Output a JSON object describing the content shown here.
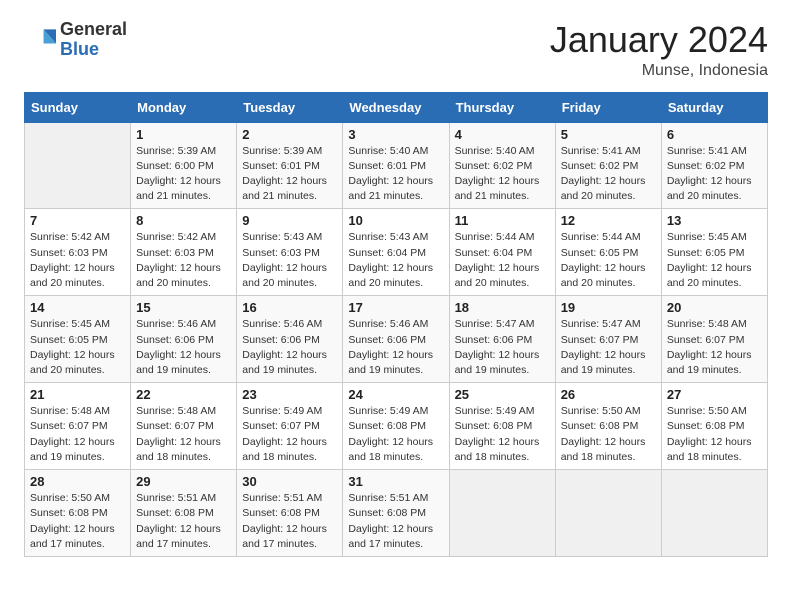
{
  "header": {
    "logo_general": "General",
    "logo_blue": "Blue",
    "month_title": "January 2024",
    "location": "Munse, Indonesia"
  },
  "days_of_week": [
    "Sunday",
    "Monday",
    "Tuesday",
    "Wednesday",
    "Thursday",
    "Friday",
    "Saturday"
  ],
  "weeks": [
    [
      {
        "day": "",
        "info": ""
      },
      {
        "day": "1",
        "info": "Sunrise: 5:39 AM\nSunset: 6:00 PM\nDaylight: 12 hours\nand 21 minutes."
      },
      {
        "day": "2",
        "info": "Sunrise: 5:39 AM\nSunset: 6:01 PM\nDaylight: 12 hours\nand 21 minutes."
      },
      {
        "day": "3",
        "info": "Sunrise: 5:40 AM\nSunset: 6:01 PM\nDaylight: 12 hours\nand 21 minutes."
      },
      {
        "day": "4",
        "info": "Sunrise: 5:40 AM\nSunset: 6:02 PM\nDaylight: 12 hours\nand 21 minutes."
      },
      {
        "day": "5",
        "info": "Sunrise: 5:41 AM\nSunset: 6:02 PM\nDaylight: 12 hours\nand 20 minutes."
      },
      {
        "day": "6",
        "info": "Sunrise: 5:41 AM\nSunset: 6:02 PM\nDaylight: 12 hours\nand 20 minutes."
      }
    ],
    [
      {
        "day": "7",
        "info": "Sunrise: 5:42 AM\nSunset: 6:03 PM\nDaylight: 12 hours\nand 20 minutes."
      },
      {
        "day": "8",
        "info": "Sunrise: 5:42 AM\nSunset: 6:03 PM\nDaylight: 12 hours\nand 20 minutes."
      },
      {
        "day": "9",
        "info": "Sunrise: 5:43 AM\nSunset: 6:03 PM\nDaylight: 12 hours\nand 20 minutes."
      },
      {
        "day": "10",
        "info": "Sunrise: 5:43 AM\nSunset: 6:04 PM\nDaylight: 12 hours\nand 20 minutes."
      },
      {
        "day": "11",
        "info": "Sunrise: 5:44 AM\nSunset: 6:04 PM\nDaylight: 12 hours\nand 20 minutes."
      },
      {
        "day": "12",
        "info": "Sunrise: 5:44 AM\nSunset: 6:05 PM\nDaylight: 12 hours\nand 20 minutes."
      },
      {
        "day": "13",
        "info": "Sunrise: 5:45 AM\nSunset: 6:05 PM\nDaylight: 12 hours\nand 20 minutes."
      }
    ],
    [
      {
        "day": "14",
        "info": "Sunrise: 5:45 AM\nSunset: 6:05 PM\nDaylight: 12 hours\nand 20 minutes."
      },
      {
        "day": "15",
        "info": "Sunrise: 5:46 AM\nSunset: 6:06 PM\nDaylight: 12 hours\nand 19 minutes."
      },
      {
        "day": "16",
        "info": "Sunrise: 5:46 AM\nSunset: 6:06 PM\nDaylight: 12 hours\nand 19 minutes."
      },
      {
        "day": "17",
        "info": "Sunrise: 5:46 AM\nSunset: 6:06 PM\nDaylight: 12 hours\nand 19 minutes."
      },
      {
        "day": "18",
        "info": "Sunrise: 5:47 AM\nSunset: 6:06 PM\nDaylight: 12 hours\nand 19 minutes."
      },
      {
        "day": "19",
        "info": "Sunrise: 5:47 AM\nSunset: 6:07 PM\nDaylight: 12 hours\nand 19 minutes."
      },
      {
        "day": "20",
        "info": "Sunrise: 5:48 AM\nSunset: 6:07 PM\nDaylight: 12 hours\nand 19 minutes."
      }
    ],
    [
      {
        "day": "21",
        "info": "Sunrise: 5:48 AM\nSunset: 6:07 PM\nDaylight: 12 hours\nand 19 minutes."
      },
      {
        "day": "22",
        "info": "Sunrise: 5:48 AM\nSunset: 6:07 PM\nDaylight: 12 hours\nand 18 minutes."
      },
      {
        "day": "23",
        "info": "Sunrise: 5:49 AM\nSunset: 6:07 PM\nDaylight: 12 hours\nand 18 minutes."
      },
      {
        "day": "24",
        "info": "Sunrise: 5:49 AM\nSunset: 6:08 PM\nDaylight: 12 hours\nand 18 minutes."
      },
      {
        "day": "25",
        "info": "Sunrise: 5:49 AM\nSunset: 6:08 PM\nDaylight: 12 hours\nand 18 minutes."
      },
      {
        "day": "26",
        "info": "Sunrise: 5:50 AM\nSunset: 6:08 PM\nDaylight: 12 hours\nand 18 minutes."
      },
      {
        "day": "27",
        "info": "Sunrise: 5:50 AM\nSunset: 6:08 PM\nDaylight: 12 hours\nand 18 minutes."
      }
    ],
    [
      {
        "day": "28",
        "info": "Sunrise: 5:50 AM\nSunset: 6:08 PM\nDaylight: 12 hours\nand 17 minutes."
      },
      {
        "day": "29",
        "info": "Sunrise: 5:51 AM\nSunset: 6:08 PM\nDaylight: 12 hours\nand 17 minutes."
      },
      {
        "day": "30",
        "info": "Sunrise: 5:51 AM\nSunset: 6:08 PM\nDaylight: 12 hours\nand 17 minutes."
      },
      {
        "day": "31",
        "info": "Sunrise: 5:51 AM\nSunset: 6:08 PM\nDaylight: 12 hours\nand 17 minutes."
      },
      {
        "day": "",
        "info": ""
      },
      {
        "day": "",
        "info": ""
      },
      {
        "day": "",
        "info": ""
      }
    ]
  ]
}
